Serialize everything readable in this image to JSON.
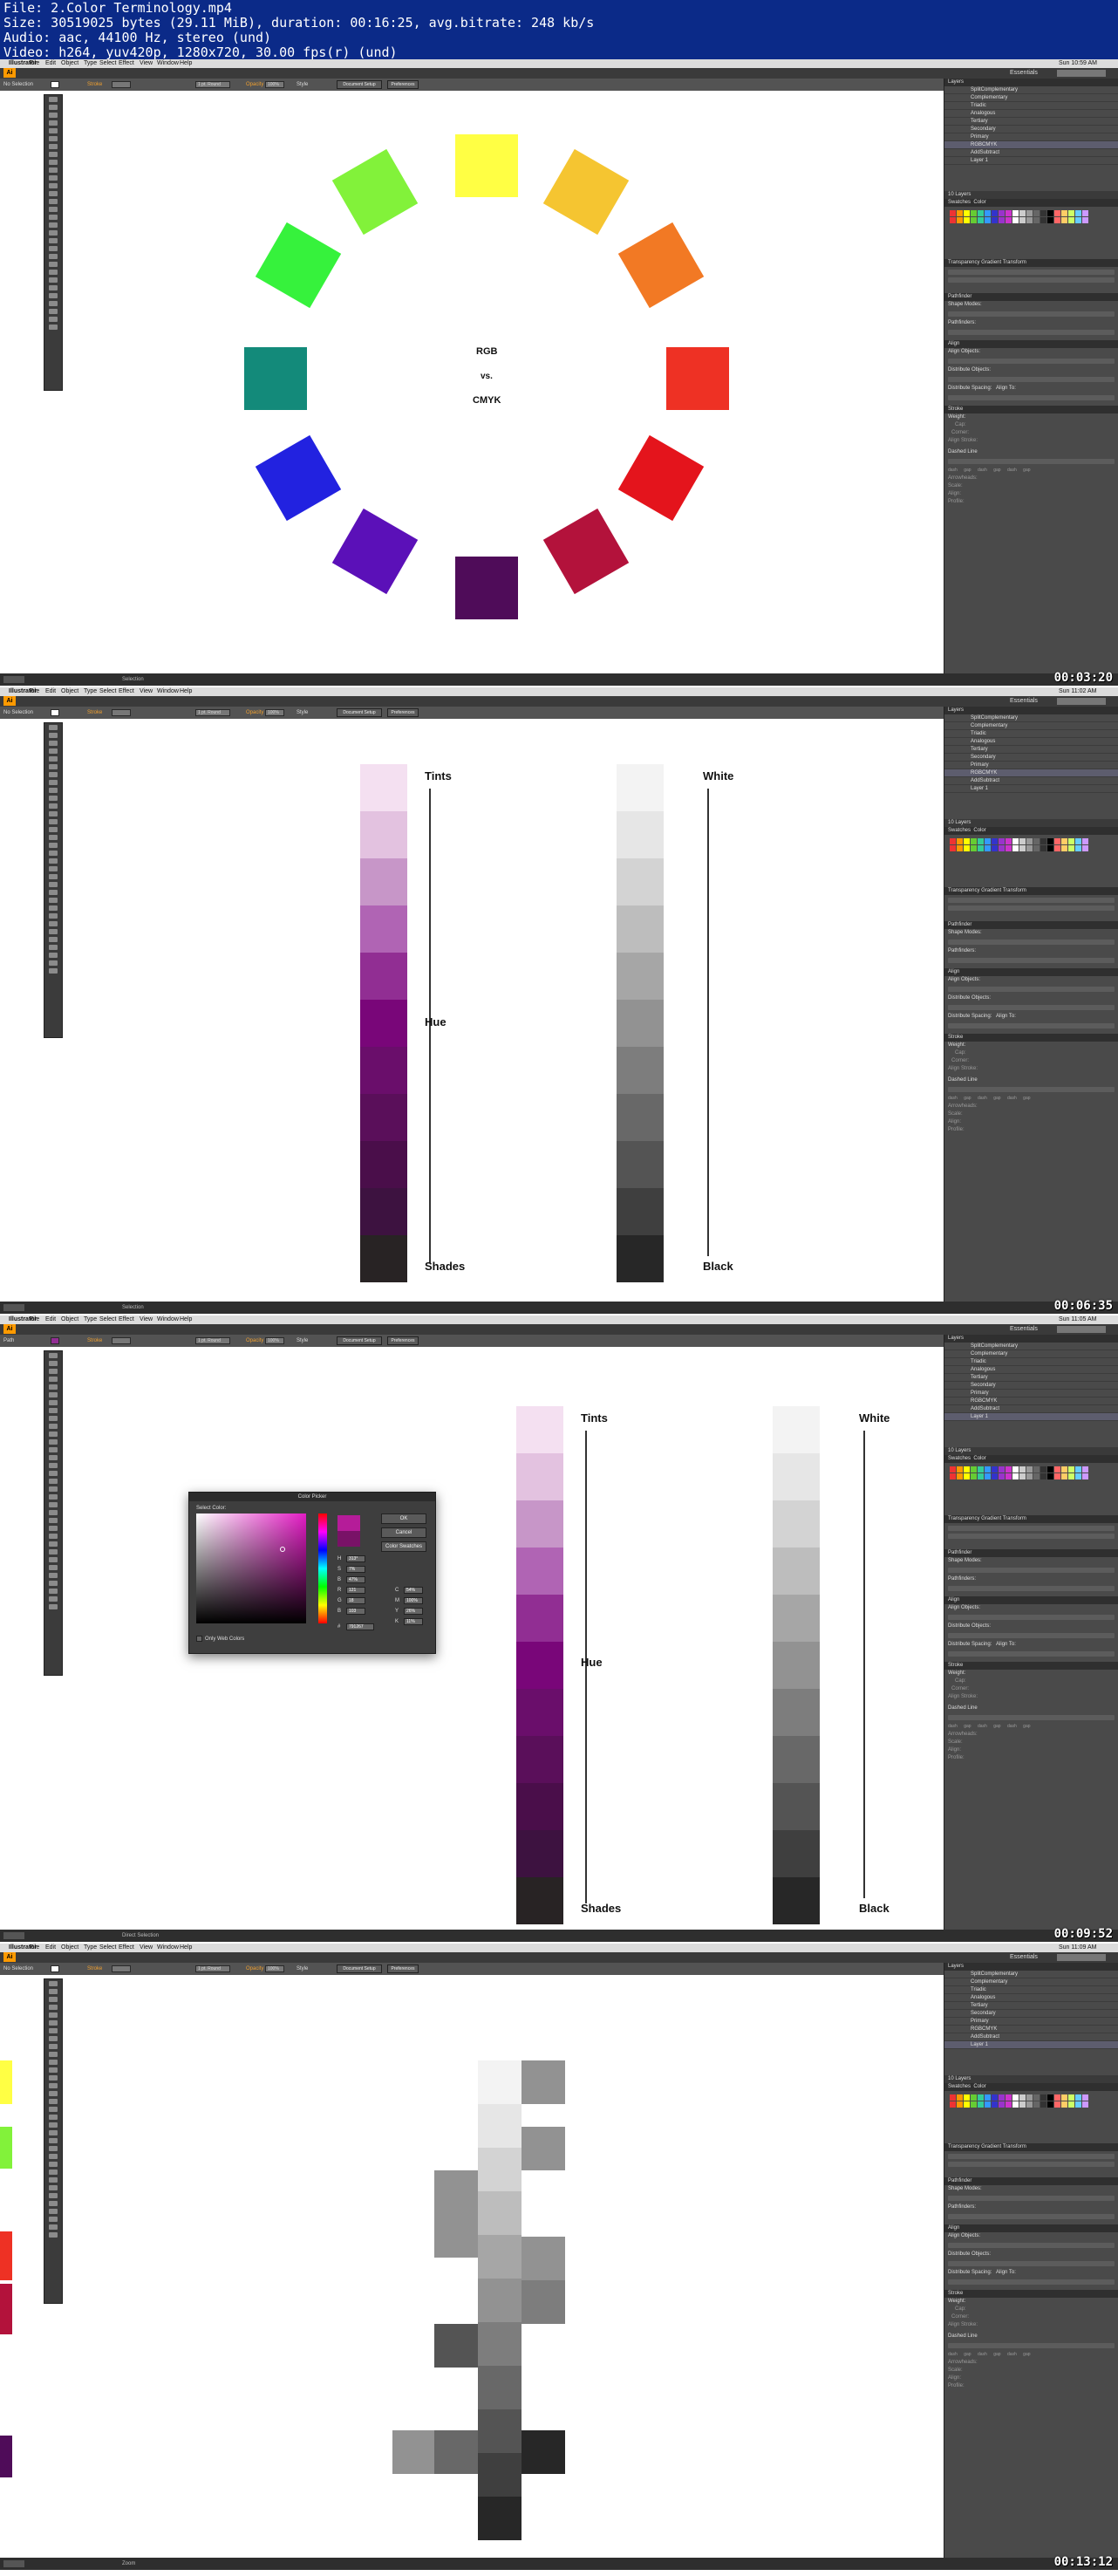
{
  "video_info": {
    "file": "File: 2.Color Terminology.mp4",
    "size": "Size: 30519025 bytes (29.11 MiB), duration: 00:16:25, avg.bitrate: 248 kb/s",
    "audio": "Audio: aac, 44100 Hz, stereo (und)",
    "video": "Video: h264, yuv420p, 1280x720, 30.00 fps(r) (und)"
  },
  "menu": {
    "items": [
      "Illustrator",
      "File",
      "Edit",
      "Object",
      "Type",
      "Select",
      "Effect",
      "View",
      "Window",
      "Help"
    ],
    "clocks": [
      "Sun 10:59 AM",
      "Sun 11:02 AM",
      "Sun 11:05 AM",
      "Sun 11:09 AM"
    ]
  },
  "workspace": "Essentials",
  "control": {
    "no_selection": "No Selection",
    "stroke": "Stroke",
    "opacity_label": "Opacity",
    "opacity_value": "100%",
    "style": "Style",
    "stroke_weight": "1 pt. Round",
    "document_setup": "Document Setup",
    "preferences": "Preferences",
    "path": "Path"
  },
  "layers_panel": {
    "title": "Layers",
    "items": [
      "SplitComplementary",
      "Complementary",
      "Triadic",
      "Analogous",
      "Tertiary",
      "Secondary",
      "Primary",
      "RGBCMYK",
      "AddSubtract",
      "Layer 1"
    ],
    "count": "10 Layers"
  },
  "panel_tabs": {
    "swatches": "Swatches",
    "color": "Color",
    "transparency": "Transparency",
    "gradient": "Gradient",
    "transform": "Transform",
    "pathfinder": "Pathfinder",
    "shape_modes": "Shape Modes:",
    "pathfinders": "Pathfinders:",
    "align": "Align",
    "align_objects": "Align Objects:",
    "distribute_objects": "Distribute Objects:",
    "distribute_spacing": "Distribute Spacing:",
    "align_to": "Align To:",
    "stroke": "Stroke",
    "weight": "Weight:",
    "cap": "Cap:",
    "corner": "Corner:",
    "align_stroke": "Align Stroke:",
    "dashed_line": "Dashed Line",
    "dash_labels": [
      "dash",
      "gap",
      "dash",
      "gap",
      "dash",
      "gap"
    ],
    "arrowheads": "Arrowheads:",
    "scale": "Scale:",
    "align_label": "Align:",
    "profile": "Profile:",
    "expand": "Expand"
  },
  "status": {
    "selection": "Selection",
    "direct": "Direct Selection",
    "zoom": "Zoom"
  },
  "timestamps": [
    "00:03:20",
    "00:06:35",
    "00:09:52",
    "00:13:12"
  ],
  "frame1": {
    "center_lines": [
      "RGB",
      "vs.",
      "CMYK"
    ],
    "wheel_colors": [
      "#ffff44",
      "#f5c531",
      "#f27924",
      "#ee3124",
      "#e4141c",
      "#b3123b",
      "#4f0c59",
      "#5b10b8",
      "#2222e0",
      "#138a7a",
      "#36f23c",
      "#82f23a"
    ]
  },
  "ramps": {
    "labels": {
      "tints": "Tints",
      "hue": "Hue",
      "shades": "Shades",
      "white": "White",
      "black": "Black"
    },
    "purple": [
      "#f4e0f1",
      "#e3c2e0",
      "#c796c8",
      "#b064b4",
      "#912e93",
      "#790679",
      "#6a0e6b",
      "#5a0f5a",
      "#4a0e4a",
      "#3d1240",
      "#282324"
    ],
    "gray": [
      "#f3f3f3",
      "#e6e6e6",
      "#d3d3d3",
      "#bdbdbd",
      "#a6a6a6",
      "#929292",
      "#7d7d7d",
      "#686868",
      "#545454",
      "#3f3f3f",
      "#272727"
    ]
  },
  "color_picker": {
    "title": "Color Picker",
    "select_color": "Select Color:",
    "ok": "OK",
    "cancel": "Cancel",
    "color_swatches": "Color Swatches",
    "web_only": "Only Web Colors",
    "fields": [
      {
        "k": "H",
        "v": "313°"
      },
      {
        "k": "S",
        "v": "7%"
      },
      {
        "k": "B",
        "v": "47%"
      },
      {
        "k": "R",
        "v": "121"
      },
      {
        "k": "G",
        "v": "18"
      },
      {
        "k": "B",
        "v": "103"
      }
    ],
    "cmyk": [
      {
        "k": "C",
        "v": "54%"
      },
      {
        "k": "M",
        "v": "100%"
      },
      {
        "k": "Y",
        "v": "26%"
      },
      {
        "k": "K",
        "v": "11%"
      }
    ],
    "hex_label": "#",
    "hex": "791267"
  }
}
